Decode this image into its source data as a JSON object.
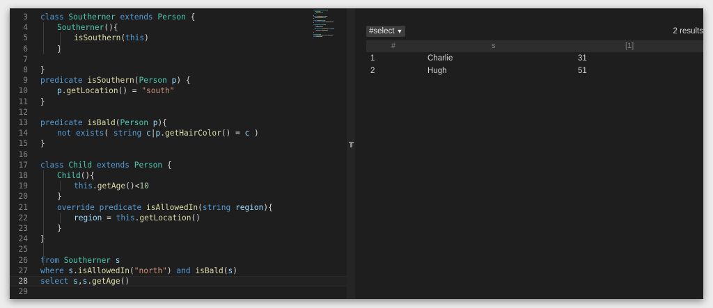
{
  "editor": {
    "current_line": 28,
    "lines": [
      {
        "n": "3",
        "indent": 0,
        "tokens": [
          [
            "class ",
            "kw"
          ],
          [
            "Southerner ",
            "ty"
          ],
          [
            "extends ",
            "kw"
          ],
          [
            "Person ",
            "ty"
          ],
          [
            "{",
            "pl"
          ]
        ]
      },
      {
        "n": "4",
        "indent": 1,
        "tokens": [
          [
            "Southerner",
            "ty"
          ],
          [
            "(){",
            "pl"
          ]
        ]
      },
      {
        "n": "5",
        "indent": 2,
        "tokens": [
          [
            "isSouthern",
            "fn"
          ],
          [
            "(",
            "pl"
          ],
          [
            "this",
            "kw"
          ],
          [
            ")",
            "pl"
          ]
        ]
      },
      {
        "n": "6",
        "indent": 1,
        "tokens": [
          [
            "}",
            "pl"
          ]
        ]
      },
      {
        "n": "7",
        "indent": 0,
        "tokens": []
      },
      {
        "n": "8",
        "indent": 0,
        "tokens": [
          [
            "}",
            "pl"
          ]
        ]
      },
      {
        "n": "9",
        "indent": 0,
        "tokens": [
          [
            "predicate ",
            "kw"
          ],
          [
            "isSouthern",
            "fn"
          ],
          [
            "(",
            "pl"
          ],
          [
            "Person ",
            "ty"
          ],
          [
            "p",
            "var"
          ],
          [
            ") {",
            "pl"
          ]
        ]
      },
      {
        "n": "10",
        "indent": 1,
        "tokens": [
          [
            "p",
            "var"
          ],
          [
            ".",
            "pl"
          ],
          [
            "getLocation",
            "fn"
          ],
          [
            "() = ",
            "pl"
          ],
          [
            "\"south\"",
            "str"
          ]
        ]
      },
      {
        "n": "11",
        "indent": 0,
        "tokens": [
          [
            "}",
            "pl"
          ]
        ]
      },
      {
        "n": "12",
        "indent": 0,
        "tokens": []
      },
      {
        "n": "13",
        "indent": 0,
        "tokens": [
          [
            "predicate ",
            "kw"
          ],
          [
            "isBald",
            "fn"
          ],
          [
            "(",
            "pl"
          ],
          [
            "Person ",
            "ty"
          ],
          [
            "p",
            "var"
          ],
          [
            "){",
            "pl"
          ]
        ]
      },
      {
        "n": "14",
        "indent": 1,
        "tokens": [
          [
            "not ",
            "kw"
          ],
          [
            "exists",
            "kw"
          ],
          [
            "( ",
            "pl"
          ],
          [
            "string ",
            "kw"
          ],
          [
            "c",
            "var"
          ],
          [
            "|",
            "pl"
          ],
          [
            "p",
            "var"
          ],
          [
            ".",
            "pl"
          ],
          [
            "getHairColor",
            "fn"
          ],
          [
            "() = ",
            "pl"
          ],
          [
            "c",
            "var"
          ],
          [
            " )",
            "pl"
          ]
        ]
      },
      {
        "n": "15",
        "indent": 0,
        "tokens": [
          [
            "}",
            "pl"
          ]
        ]
      },
      {
        "n": "16",
        "indent": 0,
        "tokens": []
      },
      {
        "n": "17",
        "indent": 0,
        "tokens": [
          [
            "class ",
            "kw"
          ],
          [
            "Child ",
            "ty"
          ],
          [
            "extends ",
            "kw"
          ],
          [
            "Person ",
            "ty"
          ],
          [
            "{",
            "pl"
          ]
        ]
      },
      {
        "n": "18",
        "indent": 1,
        "tokens": [
          [
            "Child",
            "ty"
          ],
          [
            "(){",
            "pl"
          ]
        ]
      },
      {
        "n": "19",
        "indent": 2,
        "tokens": [
          [
            "this",
            "kw"
          ],
          [
            ".",
            "pl"
          ],
          [
            "getAge",
            "fn"
          ],
          [
            "()<",
            "pl"
          ],
          [
            "10",
            "num"
          ]
        ]
      },
      {
        "n": "20",
        "indent": 1,
        "tokens": [
          [
            "}",
            "pl"
          ]
        ]
      },
      {
        "n": "21",
        "indent": 1,
        "tokens": [
          [
            "override ",
            "kw"
          ],
          [
            "predicate ",
            "kw"
          ],
          [
            "isAllowedIn",
            "fn"
          ],
          [
            "(",
            "pl"
          ],
          [
            "string ",
            "kw"
          ],
          [
            "region",
            "var"
          ],
          [
            "){",
            "pl"
          ]
        ]
      },
      {
        "n": "22",
        "indent": 2,
        "tokens": [
          [
            "region",
            "var"
          ],
          [
            " = ",
            "pl"
          ],
          [
            "this",
            "kw"
          ],
          [
            ".",
            "pl"
          ],
          [
            "getLocation",
            "fn"
          ],
          [
            "()",
            "pl"
          ]
        ]
      },
      {
        "n": "23",
        "indent": 1,
        "tokens": [
          [
            "}",
            "pl"
          ]
        ]
      },
      {
        "n": "24",
        "indent": 0,
        "tokens": [
          [
            "}",
            "pl"
          ]
        ]
      },
      {
        "n": "25",
        "indent": 0,
        "tokens": []
      },
      {
        "n": "26",
        "indent": 0,
        "tokens": [
          [
            "from ",
            "kw"
          ],
          [
            "Southerner ",
            "ty"
          ],
          [
            "s",
            "var"
          ]
        ]
      },
      {
        "n": "27",
        "indent": 0,
        "tokens": [
          [
            "where ",
            "kw"
          ],
          [
            "s",
            "var"
          ],
          [
            ".",
            "pl"
          ],
          [
            "isAllowedIn",
            "fn"
          ],
          [
            "(",
            "pl"
          ],
          [
            "\"north\"",
            "str"
          ],
          [
            ") ",
            "pl"
          ],
          [
            "and ",
            "kw"
          ],
          [
            "isBald",
            "fn"
          ],
          [
            "(",
            "pl"
          ],
          [
            "s",
            "var"
          ],
          [
            ")",
            "pl"
          ]
        ]
      },
      {
        "n": "28",
        "indent": 0,
        "tokens": [
          [
            "select ",
            "kw"
          ],
          [
            "s",
            "var"
          ],
          [
            ",",
            "pl"
          ],
          [
            "s",
            "var"
          ],
          [
            ".",
            "pl"
          ],
          [
            "getAge",
            "fn"
          ],
          [
            "()",
            "pl"
          ]
        ]
      },
      {
        "n": "29",
        "indent": 0,
        "tokens": []
      }
    ]
  },
  "results": {
    "result_set": "#select",
    "count_label": "2 results",
    "columns": [
      "#",
      "s",
      "[1]"
    ],
    "rows": [
      {
        "index": "1",
        "s": "Charlie",
        "v": "31"
      },
      {
        "index": "2",
        "s": "Hugh",
        "v": "51"
      }
    ]
  },
  "colors": {
    "keyword": "#569cd6",
    "type": "#4ec9b0",
    "function": "#dcdcaa",
    "variable": "#9cdcfe",
    "string": "#ce9178",
    "number": "#b5cea8",
    "plain": "#d4d4d4"
  },
  "icons": {
    "dropdown_caret": "chevron-down-icon",
    "sash_grip": "grip-icon"
  }
}
